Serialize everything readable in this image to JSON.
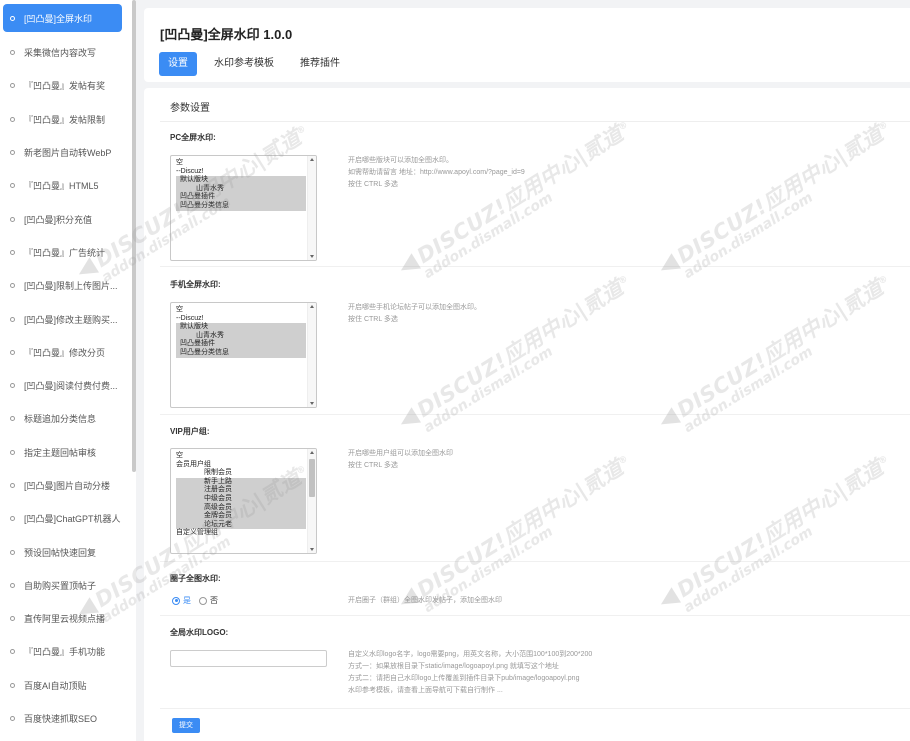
{
  "sidebar": {
    "items": [
      {
        "label": "[凹凸曼]全屏水印",
        "active": true
      },
      {
        "label": "采集微信内容改写"
      },
      {
        "label": "『凹凸曼』发帖有奖"
      },
      {
        "label": "『凹凸曼』发帖限制"
      },
      {
        "label": "新老图片自动转WebP"
      },
      {
        "label": "『凹凸曼』HTML5"
      },
      {
        "label": "[凹凸曼]积分充值"
      },
      {
        "label": "『凹凸曼』广告统计"
      },
      {
        "label": "[凹凸曼]限制上传图片..."
      },
      {
        "label": "[凹凸曼]修改主题购买..."
      },
      {
        "label": "『凹凸曼』修改分页"
      },
      {
        "label": "[凹凸曼]阅读付费付费..."
      },
      {
        "label": "标题追加分类信息"
      },
      {
        "label": "指定主题回帖审核"
      },
      {
        "label": "[凹凸曼]图片自动分楼"
      },
      {
        "label": "[凹凸曼]ChatGPT机器人"
      },
      {
        "label": "预设回帖快速回复"
      },
      {
        "label": "自助购买置顶帖子"
      },
      {
        "label": "直传阿里云视频点播"
      },
      {
        "label": "『凹凸曼』手机功能"
      },
      {
        "label": "百度AI自动顶贴"
      },
      {
        "label": "百度快速抓取SEO"
      }
    ]
  },
  "header": {
    "title": "[凹凸曼]全屏水印 1.0.0",
    "tabs": [
      {
        "label": "设置",
        "active": true
      },
      {
        "label": "水印参考模板"
      },
      {
        "label": "推荐插件"
      }
    ]
  },
  "main": {
    "section_title": "参数设置",
    "pc": {
      "label": "PC全屏水印:",
      "options": [
        {
          "text": "空",
          "indent": 0,
          "selected": false
        },
        {
          "text": "--Discuz!",
          "indent": 0,
          "selected": false
        },
        {
          "text": "默认版块",
          "indent": 1,
          "selected": true
        },
        {
          "text": "山青水秀",
          "indent": 2,
          "selected": true
        },
        {
          "text": "凹凸曼插件",
          "indent": 1,
          "selected": true
        },
        {
          "text": "凹凸曼分类信息",
          "indent": 1,
          "selected": true
        }
      ],
      "help": [
        "开启哪些版块可以添加全图水印。",
        "如需帮助请留言 地址：http://www.apoyl.com/?page_id=9",
        "按住 CTRL 多选"
      ]
    },
    "mobile": {
      "label": "手机全屏水印:",
      "options": [
        {
          "text": "空",
          "indent": 0,
          "selected": false
        },
        {
          "text": "--Discuz!",
          "indent": 0,
          "selected": false
        },
        {
          "text": "默认版块",
          "indent": 1,
          "selected": true
        },
        {
          "text": "山青水秀",
          "indent": 2,
          "selected": true
        },
        {
          "text": "凹凸曼插件",
          "indent": 1,
          "selected": true
        },
        {
          "text": "凹凸曼分类信息",
          "indent": 1,
          "selected": true
        }
      ],
      "help": [
        "开启哪些手机论坛帖子可以添加全图水印。",
        "按住 CTRL 多选"
      ]
    },
    "vip": {
      "label": "VIP用户组:",
      "options": [
        {
          "text": "空",
          "indent": 0,
          "selected": false
        },
        {
          "text": "会员用户组",
          "indent": 0,
          "selected": false
        },
        {
          "text": "限制会员",
          "indent": 3,
          "selected": false
        },
        {
          "text": "新手上路",
          "indent": 3,
          "selected": true
        },
        {
          "text": "注册会员",
          "indent": 3,
          "selected": true
        },
        {
          "text": "中级会员",
          "indent": 3,
          "selected": true
        },
        {
          "text": "高级会员",
          "indent": 3,
          "selected": true
        },
        {
          "text": "金牌会员",
          "indent": 3,
          "selected": true
        },
        {
          "text": "论坛元老",
          "indent": 3,
          "selected": true
        },
        {
          "text": "自定义管理组",
          "indent": 0,
          "selected": false
        }
      ],
      "help": [
        "开启哪些用户组可以添加全图水印",
        "按住 CTRL 多选"
      ]
    },
    "circle": {
      "label": "圈子全图水印:",
      "yes_label": "是",
      "no_label": "否",
      "value": "yes",
      "help": [
        "开启圈子（群组）全图水印发帖子，添加全图水印"
      ]
    },
    "logo": {
      "label": "全局水印LOGO:",
      "value": "",
      "help": [
        "自定义水印logo名字，logo需要png，用英文名称，大小范围100*100到200*200",
        "方式一：如果放根目录下static/image/logoapoyl.png 就填写这个地址",
        "方式二：请把自己水印logo上传覆盖到插件目录下pub/image/logoapoyl.png",
        "水印参考模板，请查看上面导航可下载自行制作 ..."
      ]
    },
    "submit_label": "提交"
  },
  "watermark": {
    "line1": "DISCUZ!应用中心|贰道",
    "line2": "addon.dismall.com",
    "symbol": "®"
  }
}
